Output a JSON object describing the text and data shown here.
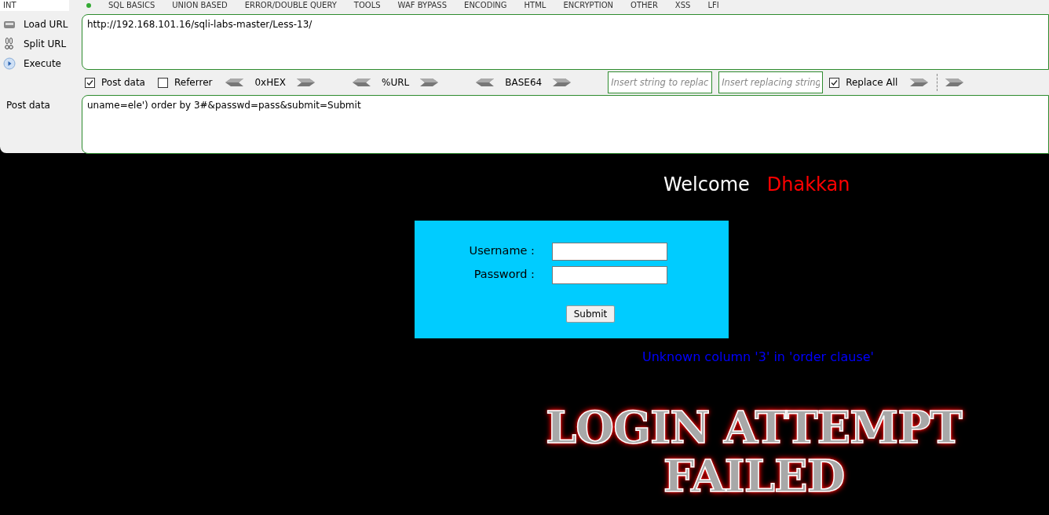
{
  "menu": [
    {
      "label": "INT",
      "selected": true
    },
    {
      "label": "SQL BASICS",
      "selected": false
    },
    {
      "label": "UNION BASED",
      "selected": false
    },
    {
      "label": "ERROR/DOUBLE QUERY",
      "selected": false
    },
    {
      "label": "TOOLS",
      "selected": false
    },
    {
      "label": "WAF BYPASS",
      "selected": false
    },
    {
      "label": "ENCODING",
      "selected": false
    },
    {
      "label": "HTML",
      "selected": false
    },
    {
      "label": "ENCRYPTION",
      "selected": false
    },
    {
      "label": "OTHER",
      "selected": false
    },
    {
      "label": "XSS",
      "selected": false
    },
    {
      "label": "LFI",
      "selected": false
    }
  ],
  "sidebar": [
    {
      "label": "Load URL",
      "kind": "load"
    },
    {
      "label": "Split URL",
      "kind": "split"
    },
    {
      "label": "Execute",
      "kind": "execute"
    }
  ],
  "url": "http://192.168.101.16/sqli-labs-master/Less-13/",
  "options": [
    {
      "label": "Post data",
      "checked": true
    },
    {
      "label": "Referrer",
      "checked": false
    }
  ],
  "encoders": [
    "0xHEX",
    "%URL",
    "BASE64"
  ],
  "replace": {
    "find_placeholder": "Insert string to replac",
    "replace_placeholder": "Insert replacing string",
    "replace_all": {
      "label": "Replace All",
      "checked": true
    }
  },
  "post_label": "Post data",
  "post_value": "uname=ele') order by 3#&passwd=pass&submit=Submit",
  "page": {
    "welcome": "Welcome",
    "name": "Dhakkan",
    "username_label": "Username :",
    "password_label": "Password :",
    "submit": "Submit",
    "error": "Unknown column '3' in 'order clause'",
    "banner": [
      "LOGIN ATTEMPT",
      "FAILED"
    ]
  }
}
